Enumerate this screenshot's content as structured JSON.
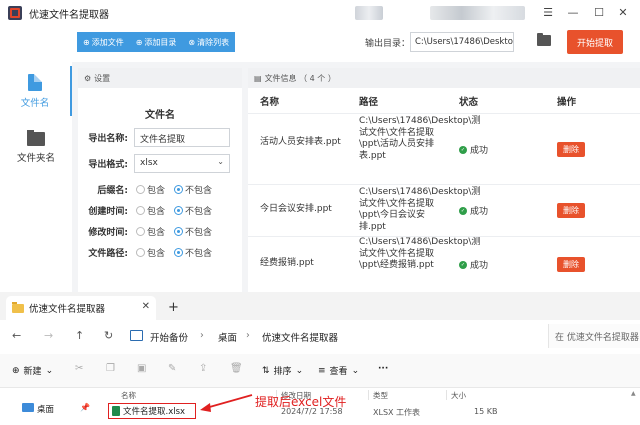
{
  "app": {
    "title": "优速文件名提取器",
    "window_controls": [
      "☰",
      "—",
      "☐",
      "✕"
    ],
    "toolbar": {
      "add_file": "添加文件",
      "add_dir": "添加目录",
      "clear_list": "清除列表",
      "output_label": "输出目录：",
      "output_path": "C:\\Users\\17486\\Deskto",
      "start": "开始提取"
    },
    "sidebar": [
      {
        "label": "文件名",
        "active": true
      },
      {
        "label": "文件夹名",
        "active": false
      }
    ],
    "settings": {
      "header": "设置",
      "title": "文件名",
      "export_name_label": "导出名称:",
      "export_name_value": "文件名提取",
      "export_format_label": "导出格式:",
      "export_format_value": "xlsx",
      "options": [
        {
          "label": "后缀名:",
          "include": "包含",
          "exclude": "不包含",
          "selected": "exclude"
        },
        {
          "label": "创建时间:",
          "include": "包含",
          "exclude": "不包含",
          "selected": "exclude"
        },
        {
          "label": "修改时间:",
          "include": "包含",
          "exclude": "不包含",
          "selected": "exclude"
        },
        {
          "label": "文件路径:",
          "include": "包含",
          "exclude": "不包含",
          "selected": "exclude"
        }
      ]
    },
    "file_panel": {
      "header": "文件信息 （ 4 个 ）",
      "columns": [
        "名称",
        "路径",
        "状态",
        "操作"
      ],
      "rows": [
        {
          "name": "活动人员安排表.ppt",
          "path": "C:\\Users\\17486\\Desktop\\测试文件\\文件名提取\\ppt\\活动人员安排表.ppt",
          "status": "成功",
          "action": "删除"
        },
        {
          "name": "今日会议安排.ppt",
          "path": "C:\\Users\\17486\\Desktop\\测试文件\\文件名提取\\ppt\\今日会议安排.ppt",
          "status": "成功",
          "action": "删除"
        },
        {
          "name": "经费报销.ppt",
          "path": "C:\\Users\\17486\\Desktop\\测试文件\\文件名提取\\ppt\\经费报销.ppt",
          "status": "成功",
          "action": "删除"
        }
      ]
    }
  },
  "explorer": {
    "tab_title": "优速文件名提取器",
    "breadcrumb": [
      "开始备份",
      "桌面",
      "优速文件名提取器"
    ],
    "search_placeholder": "在 优速文件名提取器",
    "commands": {
      "new": "新建",
      "sort": "排序",
      "view": "查看",
      "more": "···"
    },
    "columns": [
      "名称",
      "修改日期",
      "类型",
      "大小"
    ],
    "nav_item": "桌面",
    "file": {
      "name": "文件名提取.xlsx",
      "modified": "2024/7/2 17:58",
      "type": "XLSX 工作表",
      "size": "15 KB"
    },
    "annotation": "提取后excel文件"
  },
  "colors": {
    "accent": "#3f9ae0",
    "danger": "#e8522c",
    "success": "#2f9e49",
    "annotation": "#e02020"
  }
}
